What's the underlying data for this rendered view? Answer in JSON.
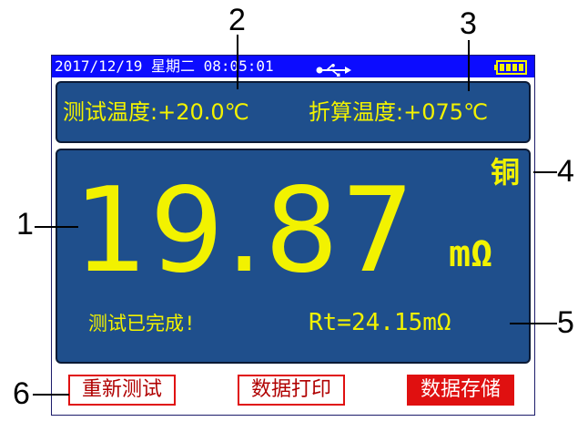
{
  "status_bar": {
    "datetime": "2017/12/19 星期二 08:05:01"
  },
  "temperatures": {
    "test_temp": "测试温度:+20.0℃",
    "converted_temp": "折算温度:+075℃"
  },
  "measurement": {
    "material": "铜",
    "value": "19.87",
    "unit": "mΩ",
    "status": "测试已完成!",
    "rt": "Rt=24.15mΩ"
  },
  "softkeys": {
    "retest": "重新测试",
    "print": "数据打印",
    "store": "数据存储"
  },
  "callouts": {
    "c1": "1",
    "c2": "2",
    "c3": "3",
    "c4": "4",
    "c5": "5",
    "c6": "6"
  },
  "colors": {
    "panel_bg": "#1f4f8c",
    "value_text": "#f2f200",
    "status_bar": "#0c0cff",
    "key_border": "#e01010"
  },
  "icons": {
    "usb": "usb-icon",
    "battery": "battery-icon"
  }
}
